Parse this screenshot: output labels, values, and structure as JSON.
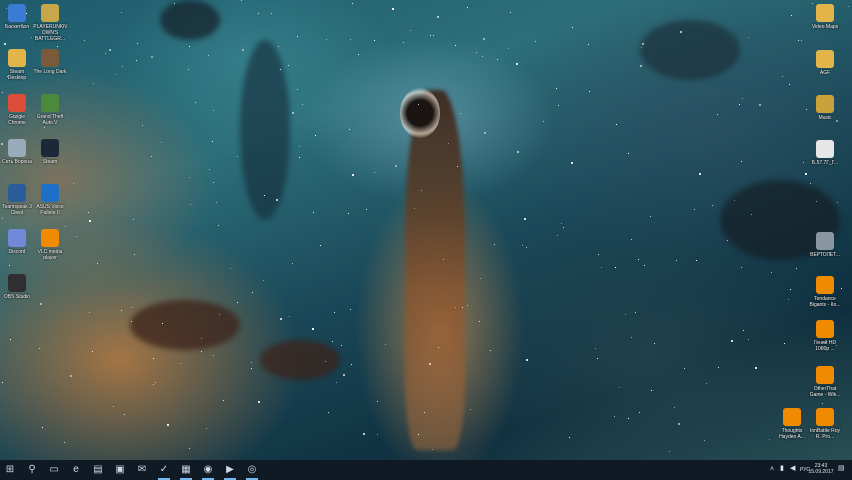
{
  "desktop": {
    "left_icons": [
      {
        "label": "Баскетбол",
        "icon": "user-folder-icon",
        "color": "#3a7bd5"
      },
      {
        "label": "PLAYERUNKNOWN'S BATTLEGR...",
        "icon": "pubg-icon",
        "color": "#c8a64a"
      },
      {
        "label": "Steam Desktop",
        "icon": "folder-icon",
        "color": "#e2b54a"
      },
      {
        "label": "The Long Dark",
        "icon": "long-dark-icon",
        "color": "#7a5a3a"
      },
      {
        "label": "Google Chrome",
        "icon": "chrome-icon",
        "color": "#dd4b39"
      },
      {
        "label": "Grand Theft Auto V",
        "icon": "gta-icon",
        "color": "#4a8a3a"
      },
      {
        "label": "Сеть Ворона",
        "icon": "recycle-bin-icon",
        "color": "#9ab"
      },
      {
        "label": "Steam",
        "icon": "steam-icon",
        "color": "#1b2838"
      },
      {
        "label": "Teamspeak 3 Client",
        "icon": "teamspeak-icon",
        "color": "#2a5d9a"
      },
      {
        "label": "ASUS Voice Pallete II",
        "icon": "asus-icon",
        "color": "#1e6fc8"
      },
      {
        "label": "Discord",
        "icon": "discord-icon",
        "color": "#7289da"
      },
      {
        "label": "VLC media player",
        "icon": "vlc-icon",
        "color": "#f08a00"
      },
      {
        "label": "OBS Studio",
        "icon": "obs-icon",
        "color": "#302e31"
      }
    ],
    "right_icons": [
      {
        "label": "Video Maps",
        "icon": "folder-icon",
        "color": "#e2b54a"
      },
      {
        "label": "AGF",
        "icon": "folder-icon",
        "color": "#e2b54a"
      },
      {
        "label": "Music",
        "icon": "music-folder-icon",
        "color": "#c9a23c"
      },
      {
        "label": "Б.57.7Г_Г...",
        "icon": "document-icon",
        "color": "#e6e6e6"
      },
      {
        "label": "ВЕРТОЛЕТ...",
        "icon": "image-file-icon",
        "color": "#8a97a3"
      },
      {
        "label": "Tendance Bigants - Ко...",
        "icon": "vlc-icon",
        "color": "#f08a00"
      },
      {
        "label": "Гений HD 1080p ...",
        "icon": "vlc-icon",
        "color": "#f08a00"
      },
      {
        "label": "OtherThat Game - Wik...",
        "icon": "vlc-icon",
        "color": "#f08a00"
      },
      {
        "label": "Thoughts Hayden A...",
        "icon": "vlc-icon",
        "color": "#f08a00"
      },
      {
        "label": "InnBattle Roy R. Pro...",
        "icon": "vlc-icon",
        "color": "#f08a00"
      }
    ]
  },
  "taskbar": {
    "start_glyph": "⊞",
    "buttons": [
      {
        "name": "search",
        "glyph": "⚲"
      },
      {
        "name": "task-view",
        "glyph": "▭"
      },
      {
        "name": "edge",
        "glyph": "e"
      },
      {
        "name": "file-explorer",
        "glyph": "▤"
      },
      {
        "name": "store",
        "glyph": "▣"
      },
      {
        "name": "mail",
        "glyph": "✉"
      },
      {
        "name": "photoshop",
        "glyph": "✓"
      },
      {
        "name": "app",
        "glyph": "▦"
      },
      {
        "name": "steam",
        "glyph": "◉"
      },
      {
        "name": "tv",
        "glyph": "▶"
      },
      {
        "name": "chrome",
        "glyph": "◎"
      }
    ],
    "tray": {
      "time": "23:43",
      "date": "15.09.2017",
      "lang": "РУС"
    }
  }
}
